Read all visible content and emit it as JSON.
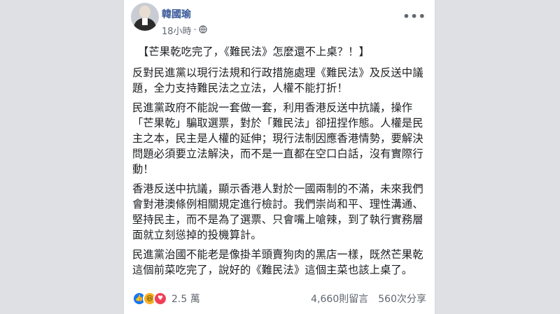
{
  "post": {
    "author": "韓國瑜",
    "time": "18小時",
    "separator": "·",
    "more": "•••",
    "paragraphs": [
      "【芒果乾吃完了，《難民法》怎麼還不上桌？！】",
      "反對民進黨以現行法規和行政措施處理《難民法》及反送中議題，全力支持難民法之立法，人權不能打折！",
      "民進黨政府不能說一套做一套，利用香港反送中抗議，操作「芒果乾」騙取選票，對於「難民法」卻扭捏作態。人權是民主之本，民主是人權的延伸；現行法制因應香港情勢，要解決問題必須要立法解決，而不是一直都在空口白話，沒有實際行動！",
      "香港反送中抗議，顯示香港人對於一國兩制的不滿，未來我們會對港澳條例相關規定進行檢討。我們崇尚和平、理性溝通、堅持民主，而不是為了選票、只會嘴上嗆辣，到了執行實務層面就立刻慫掉的投機算計。",
      "民進黨治國不能老是像掛羊頭賣狗肉的黑店一樣，既然芒果乾這個前菜吃完了，說好的《難民法》這個主菜也該上桌了。"
    ]
  },
  "footer": {
    "reaction_count": "2.5 萬",
    "comments": "4,660則留言",
    "shares": "560次分享"
  },
  "icons": {
    "reactions": [
      "like-icon",
      "haha-icon",
      "love-icon"
    ],
    "privacy": "globe-icon"
  },
  "colors": {
    "author_link": "#385898",
    "like": "#1877f2",
    "haha": "#f7b125",
    "love": "#f33e58"
  }
}
